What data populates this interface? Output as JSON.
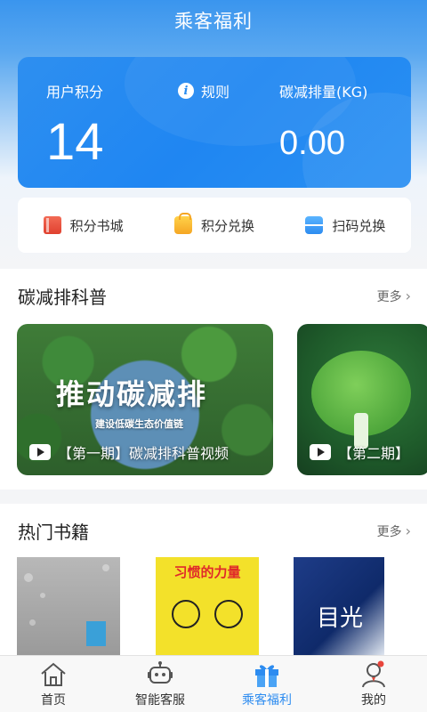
{
  "header": {
    "title": "乘客福利"
  },
  "points_card": {
    "points_label": "用户积分",
    "points_value": "14",
    "rules_label": "规则",
    "carbon_label": "碳减排量(KG)",
    "carbon_value": "0.00"
  },
  "shortcuts": [
    {
      "label": "积分书城",
      "icon": "book-icon"
    },
    {
      "label": "积分兑换",
      "icon": "shopping-bag-icon"
    },
    {
      "label": "扫码兑换",
      "icon": "scan-icon"
    }
  ],
  "science": {
    "title": "碳减排科普",
    "more": "更多",
    "videos": [
      {
        "headline": "推动碳减排",
        "subline": "建设低碳生态价值链",
        "caption": "【第一期】碳减排科普视频"
      },
      {
        "caption": "【第二期】"
      }
    ]
  },
  "books": {
    "title": "热门书籍",
    "more": "更多",
    "items": [
      {
        "cover_text": ""
      },
      {
        "cover_text": "习惯的力量"
      },
      {
        "cover_text": "目光"
      }
    ]
  },
  "tabbar": {
    "items": [
      {
        "label": "首页",
        "icon": "home-icon",
        "active": false
      },
      {
        "label": "智能客服",
        "icon": "robot-icon",
        "active": false
      },
      {
        "label": "乘客福利",
        "icon": "gift-icon",
        "active": true
      },
      {
        "label": "我的",
        "icon": "user-icon",
        "active": false
      }
    ]
  },
  "colors": {
    "accent": "#2d8cf0",
    "card_blue": "#1f86f2"
  }
}
